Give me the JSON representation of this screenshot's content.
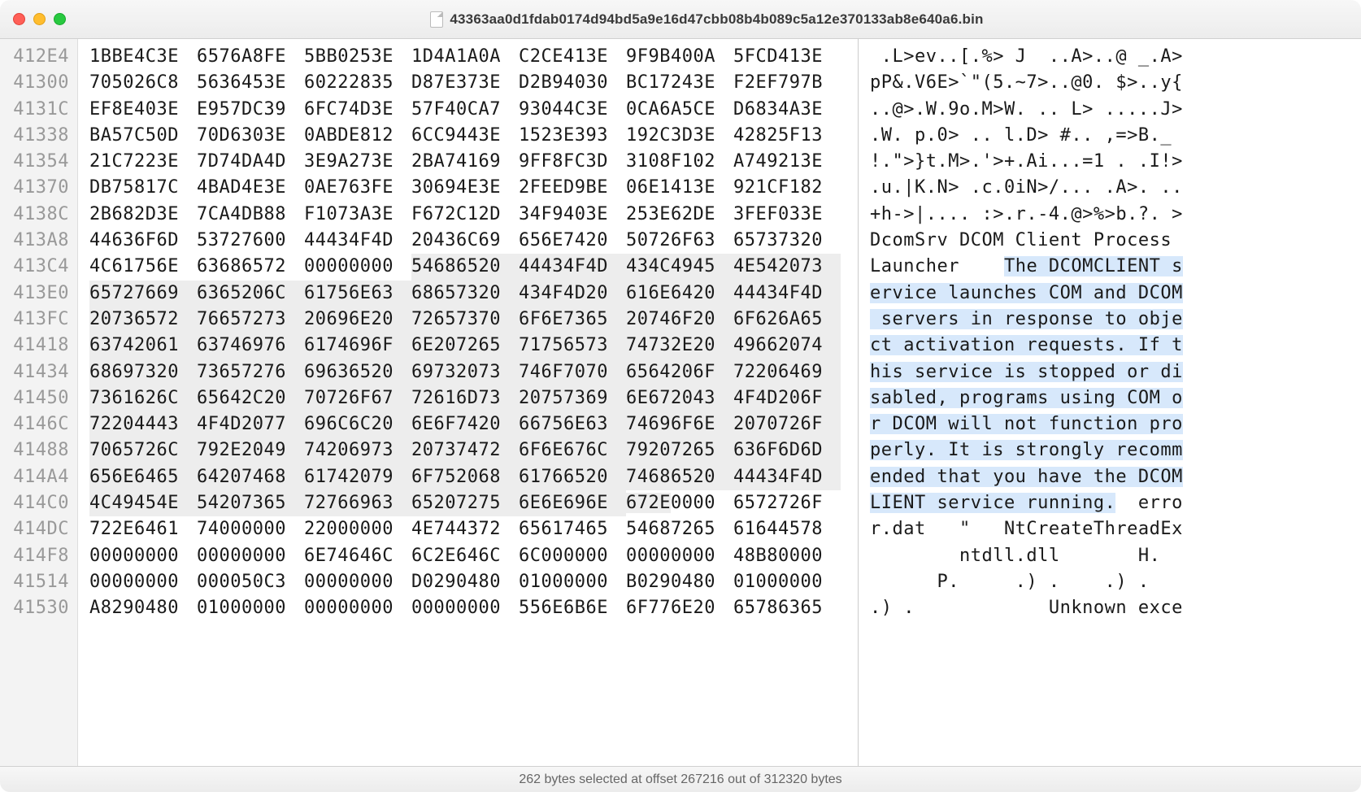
{
  "window": {
    "title": "43363aa0d1fdab0174d94bd5a9e16d47cbb08b4b089c5a12e370133ab8e640a6.bin"
  },
  "statusbar": {
    "text": "262 bytes selected at offset 267216 out of 312320 bytes"
  },
  "rows": [
    {
      "offset": "412E4",
      "hex": [
        "1BBE4C3E",
        "6576A8FE",
        "5BB0253E",
        "1D4A1A0A",
        "C2CE413E",
        "9F9B400A",
        "5FCD413E"
      ],
      "ascii": " .L>ev..[.%> J  ..A>..@ _.A>",
      "sel": false,
      "selStart": 0,
      "selEnd": 0,
      "asciiSelStart": 0,
      "asciiSelEnd": 0
    },
    {
      "offset": "41300",
      "hex": [
        "705026C8",
        "5636453E",
        "60222835",
        "D87E373E",
        "D2B94030",
        "BC17243E",
        "F2EF797B"
      ],
      "ascii": "pP&.V6E>`\"(5.~7>..@0. $>..y{",
      "sel": false,
      "selStart": 0,
      "selEnd": 0,
      "asciiSelStart": 0,
      "asciiSelEnd": 0
    },
    {
      "offset": "4131C",
      "hex": [
        "EF8E403E",
        "E957DC39",
        "6FC74D3E",
        "57F40CA7",
        "93044C3E",
        "0CA6A5CE",
        "D6834A3E"
      ],
      "ascii": "..@>.W.9o.M>W. .. L> .....J>",
      "sel": false,
      "selStart": 0,
      "selEnd": 0,
      "asciiSelStart": 0,
      "asciiSelEnd": 0
    },
    {
      "offset": "41338",
      "hex": [
        "BA57C50D",
        "70D6303E",
        "0ABDE812",
        "6CC9443E",
        "1523E393",
        "192C3D3E",
        "42825F13"
      ],
      "ascii": ".W. p.0> .. l.D> #.. ,=>B._ ",
      "sel": false,
      "selStart": 0,
      "selEnd": 0,
      "asciiSelStart": 0,
      "asciiSelEnd": 0
    },
    {
      "offset": "41354",
      "hex": [
        "21C7223E",
        "7D74DA4D",
        "3E9A273E",
        "2BA74169",
        "9FF8FC3D",
        "3108F102",
        "A749213E"
      ],
      "ascii": "!.\">}t.M>.'>+.Ai...=1 . .I!>",
      "sel": false,
      "selStart": 0,
      "selEnd": 0,
      "asciiSelStart": 0,
      "asciiSelEnd": 0
    },
    {
      "offset": "41370",
      "hex": [
        "DB75817C",
        "4BAD4E3E",
        "0AE763FE",
        "30694E3E",
        "2FEED9BE",
        "06E1413E",
        "921CF182"
      ],
      "ascii": ".u.|K.N> .c.0iN>/... .A>. ..",
      "sel": false,
      "selStart": 0,
      "selEnd": 0,
      "asciiSelStart": 0,
      "asciiSelEnd": 0
    },
    {
      "offset": "4138C",
      "hex": [
        "2B682D3E",
        "7CA4DB88",
        "F1073A3E",
        "F672C12D",
        "34F9403E",
        "253E62DE",
        "3FEF033E"
      ],
      "ascii": "+h->|.... :>.r.-4.@>%>b.?. >",
      "sel": false,
      "selStart": 0,
      "selEnd": 0,
      "asciiSelStart": 0,
      "asciiSelEnd": 0
    },
    {
      "offset": "413A8",
      "hex": [
        "44636F6D",
        "53727600",
        "44434F4D",
        "20436C69",
        "656E7420",
        "50726F63",
        "65737320"
      ],
      "ascii": "DcomSrv DCOM Client Process ",
      "sel": false,
      "selStart": 0,
      "selEnd": 0,
      "asciiSelStart": 0,
      "asciiSelEnd": 0
    },
    {
      "offset": "413C4",
      "hex": [
        "4C61756E",
        "63686572",
        "00000000",
        "54686520",
        "44434F4D",
        "434C4945",
        "4E542073"
      ],
      "ascii": "Launcher    The DCOMCLIENT s",
      "sel": true,
      "selStart": 3,
      "selEnd": 7,
      "asciiSelStart": 12,
      "asciiSelEnd": 28
    },
    {
      "offset": "413E0",
      "hex": [
        "65727669",
        "6365206C",
        "61756E63",
        "68657320",
        "434F4D20",
        "616E6420",
        "44434F4D"
      ],
      "ascii": "ervice launches COM and DCOM",
      "sel": true,
      "selStart": 0,
      "selEnd": 7,
      "asciiSelStart": 0,
      "asciiSelEnd": 28
    },
    {
      "offset": "413FC",
      "hex": [
        "20736572",
        "76657273",
        "20696E20",
        "72657370",
        "6F6E7365",
        "20746F20",
        "6F626A65"
      ],
      "ascii": " servers in response to obje",
      "sel": true,
      "selStart": 0,
      "selEnd": 7,
      "asciiSelStart": 0,
      "asciiSelEnd": 28
    },
    {
      "offset": "41418",
      "hex": [
        "63742061",
        "63746976",
        "6174696F",
        "6E207265",
        "71756573",
        "74732E20",
        "49662074"
      ],
      "ascii": "ct activation requests. If t",
      "sel": true,
      "selStart": 0,
      "selEnd": 7,
      "asciiSelStart": 0,
      "asciiSelEnd": 28
    },
    {
      "offset": "41434",
      "hex": [
        "68697320",
        "73657276",
        "69636520",
        "69732073",
        "746F7070",
        "6564206F",
        "72206469"
      ],
      "ascii": "his service is stopped or di",
      "sel": true,
      "selStart": 0,
      "selEnd": 7,
      "asciiSelStart": 0,
      "asciiSelEnd": 28
    },
    {
      "offset": "41450",
      "hex": [
        "7361626C",
        "65642C20",
        "70726F67",
        "72616D73",
        "20757369",
        "6E672043",
        "4F4D206F"
      ],
      "ascii": "sabled, programs using COM o",
      "sel": true,
      "selStart": 0,
      "selEnd": 7,
      "asciiSelStart": 0,
      "asciiSelEnd": 28
    },
    {
      "offset": "4146C",
      "hex": [
        "72204443",
        "4F4D2077",
        "696C6C20",
        "6E6F7420",
        "66756E63",
        "74696F6E",
        "2070726F"
      ],
      "ascii": "r DCOM will not function pro",
      "sel": true,
      "selStart": 0,
      "selEnd": 7,
      "asciiSelStart": 0,
      "asciiSelEnd": 28
    },
    {
      "offset": "41488",
      "hex": [
        "7065726C",
        "792E2049",
        "74206973",
        "20737472",
        "6F6E676C",
        "79207265",
        "636F6D6D"
      ],
      "ascii": "perly. It is strongly recomm",
      "sel": true,
      "selStart": 0,
      "selEnd": 7,
      "asciiSelStart": 0,
      "asciiSelEnd": 28
    },
    {
      "offset": "414A4",
      "hex": [
        "656E6465",
        "64207468",
        "61742079",
        "6F752068",
        "61766520",
        "74686520",
        "44434F4D"
      ],
      "ascii": "ended that you have the DCOM",
      "sel": true,
      "selStart": 0,
      "selEnd": 7,
      "asciiSelStart": 0,
      "asciiSelEnd": 28
    },
    {
      "offset": "414C0",
      "hex": [
        "4C49454E",
        "54207365",
        "72766963",
        "65207275",
        "6E6E696E",
        "672E0000",
        "6572726F"
      ],
      "ascii": "LIENT service running.  erro",
      "sel": true,
      "selStart": 0,
      "selEnd": 5,
      "asciiSelStart": 0,
      "asciiSelEnd": 22
    },
    {
      "offset": "414DC",
      "hex": [
        "722E6461",
        "74000000",
        "22000000",
        "4E744372",
        "65617465",
        "54687265",
        "61644578"
      ],
      "ascii": "r.dat   \"   NtCreateThreadEx",
      "sel": false,
      "selStart": 0,
      "selEnd": 0,
      "asciiSelStart": 0,
      "asciiSelEnd": 0
    },
    {
      "offset": "414F8",
      "hex": [
        "00000000",
        "00000000",
        "6E74646C",
        "6C2E646C",
        "6C000000",
        "00000000",
        "48B80000"
      ],
      "ascii": "        ntdll.dll       H.  ",
      "sel": false,
      "selStart": 0,
      "selEnd": 0,
      "asciiSelStart": 0,
      "asciiSelEnd": 0
    },
    {
      "offset": "41514",
      "hex": [
        "00000000",
        "000050C3",
        "00000000",
        "D0290480",
        "01000000",
        "B0290480",
        "01000000"
      ],
      "ascii": "      P.     .) .    .) .   ",
      "sel": false,
      "selStart": 0,
      "selEnd": 0,
      "asciiSelStart": 0,
      "asciiSelEnd": 0
    },
    {
      "offset": "41530",
      "hex": [
        "A8290480",
        "01000000",
        "00000000",
        "00000000",
        "556E6B6E",
        "6F776E20",
        "65786365"
      ],
      "ascii": ".) .            Unknown exce",
      "sel": false,
      "selStart": 0,
      "selEnd": 0,
      "asciiSelStart": 0,
      "asciiSelEnd": 0
    }
  ]
}
